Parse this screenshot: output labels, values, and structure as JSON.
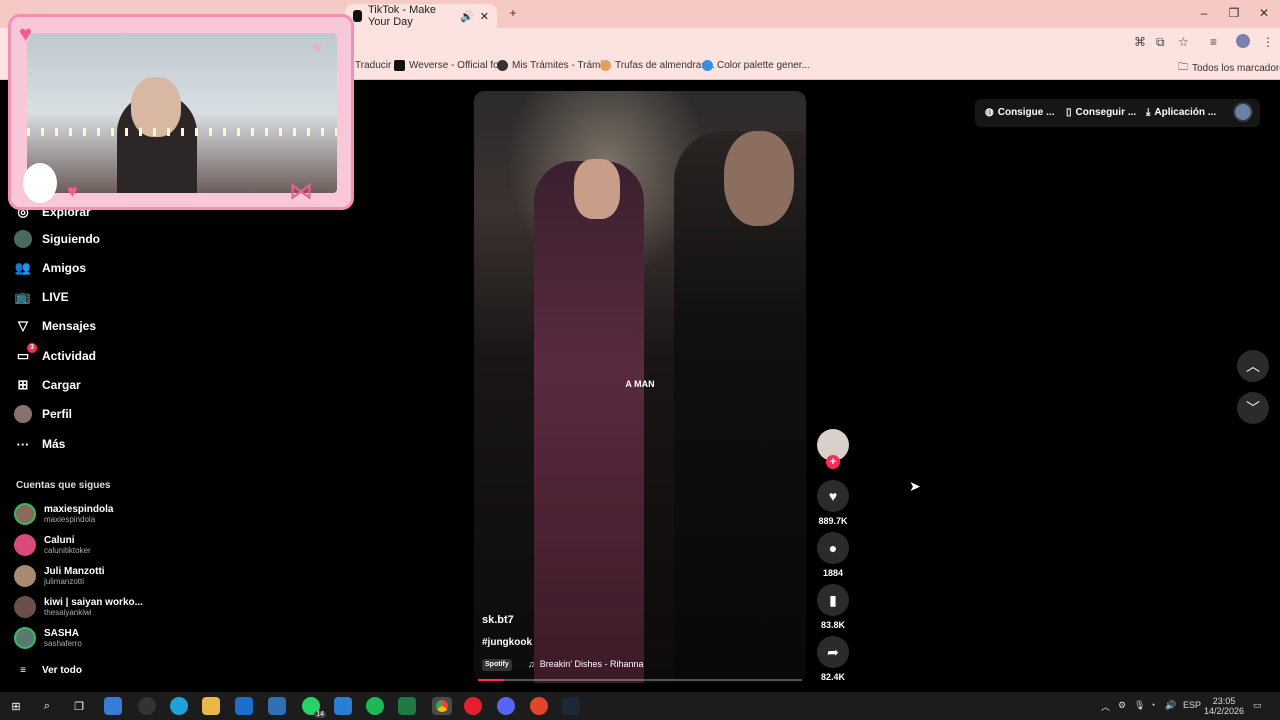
{
  "browser": {
    "tab_title": "TikTok - Make Your Day",
    "bookmarks": [
      "Traducir",
      "Weverse - Official fo...",
      "Mis Trámites - Trámi...",
      "Trufas de almendras...",
      "Color palette gener..."
    ],
    "all_bookmarks": "Todos los marcadores"
  },
  "sidebar": {
    "nav": [
      {
        "label": "Explorar",
        "icon": "compass-icon"
      },
      {
        "label": "Siguiendo",
        "icon": "following-icon"
      },
      {
        "label": "Amigos",
        "icon": "friends-icon"
      },
      {
        "label": "LIVE",
        "icon": "live-icon"
      },
      {
        "label": "Mensajes",
        "icon": "messages-icon"
      },
      {
        "label": "Actividad",
        "icon": "activity-icon",
        "badge": "3"
      },
      {
        "label": "Cargar",
        "icon": "upload-icon"
      },
      {
        "label": "Perfil",
        "icon": "profile-icon"
      },
      {
        "label": "Más",
        "icon": "more-icon"
      }
    ],
    "following_title": "Cuentas que sigues",
    "accounts": [
      {
        "name": "maxiespindola",
        "handle": "maxiespindola",
        "color": "#8a6a5a"
      },
      {
        "name": "Caluni",
        "handle": "calunitiktoker",
        "color": "#d94a7a"
      },
      {
        "name": "Juli Manzotti",
        "handle": "julimanzotti",
        "color": "#a88a70"
      },
      {
        "name": "kiwi | saiyan worko...",
        "handle": "thesaiyankiwi",
        "color": "#6a5048"
      },
      {
        "name": "SASHA",
        "handle": "sashaferro",
        "color": "#5a7a70"
      }
    ],
    "see_all": "Ver todo"
  },
  "header": {
    "get_coins": "Consigue ...",
    "get_app": "Conseguir ...",
    "app": "Aplicación ..."
  },
  "video": {
    "caption_overlay": "A MAN",
    "author": "sk.bt7",
    "hashtag": "#jungkook",
    "music_source": "Spotify",
    "music": "Breakin' Dishes - Rihanna",
    "progress": 0.08
  },
  "actions": {
    "likes": "889.7K",
    "comments": "1884",
    "saves": "83.8K",
    "shares": "82.4K"
  },
  "taskbar": {
    "lang": "ESP",
    "time": "23:05",
    "date": "14/2/2026",
    "whatsapp_badge": "14"
  },
  "colors": {
    "accent": "#fe2c55",
    "overlay_frame": "#f8c8d8"
  }
}
